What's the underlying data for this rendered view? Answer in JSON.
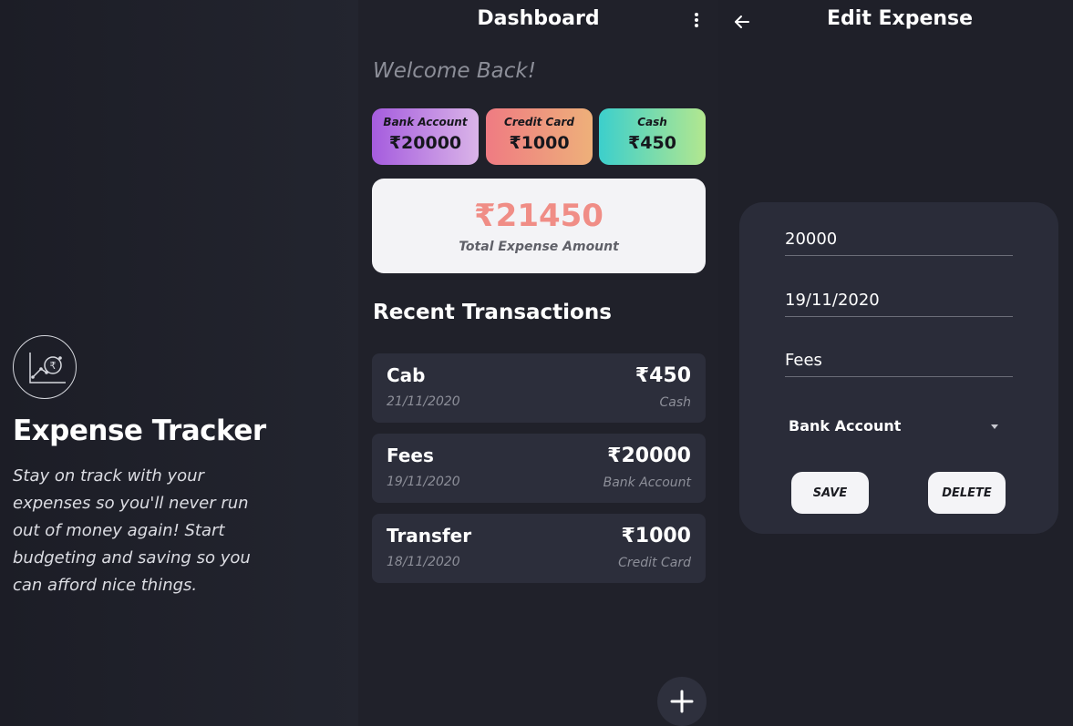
{
  "colors": {
    "background": "#1c1d25",
    "card": "#2c2e3b",
    "total_amount": "#f08d86",
    "muted_text": "#8d8f99"
  },
  "splash": {
    "logo_icon": "chart-rupee-icon",
    "title": "Expense Tracker",
    "tagline": "Stay on track with your expenses so you'll never run out of money again! Start budgeting and saving so you can afford nice things."
  },
  "dashboard": {
    "title": "Dashboard",
    "menu_icon": "more-vertical-icon",
    "welcome": "Welcome Back!",
    "accounts": [
      {
        "label": "Bank Account",
        "amount": "₹20000"
      },
      {
        "label": "Credit Card",
        "amount": "₹1000"
      },
      {
        "label": "Cash",
        "amount": "₹450"
      }
    ],
    "total": {
      "amount": "₹21450",
      "label": "Total Expense Amount"
    },
    "recent_title": "Recent Transactions",
    "transactions": [
      {
        "name": "Cab",
        "date": "21/11/2020",
        "amount": "₹450",
        "account": "Cash"
      },
      {
        "name": "Fees",
        "date": "19/11/2020",
        "amount": "₹20000",
        "account": "Bank Account"
      },
      {
        "name": "Transfer",
        "date": "18/11/2020",
        "amount": "₹1000",
        "account": "Credit Card"
      }
    ],
    "fab_icon": "plus-icon"
  },
  "edit": {
    "title": "Edit Expense",
    "back_icon": "arrow-left-icon",
    "amount": "20000",
    "date": "19/11/2020",
    "description": "Fees",
    "account": "Bank Account",
    "save_label": "SAVE",
    "delete_label": "DELETE"
  }
}
